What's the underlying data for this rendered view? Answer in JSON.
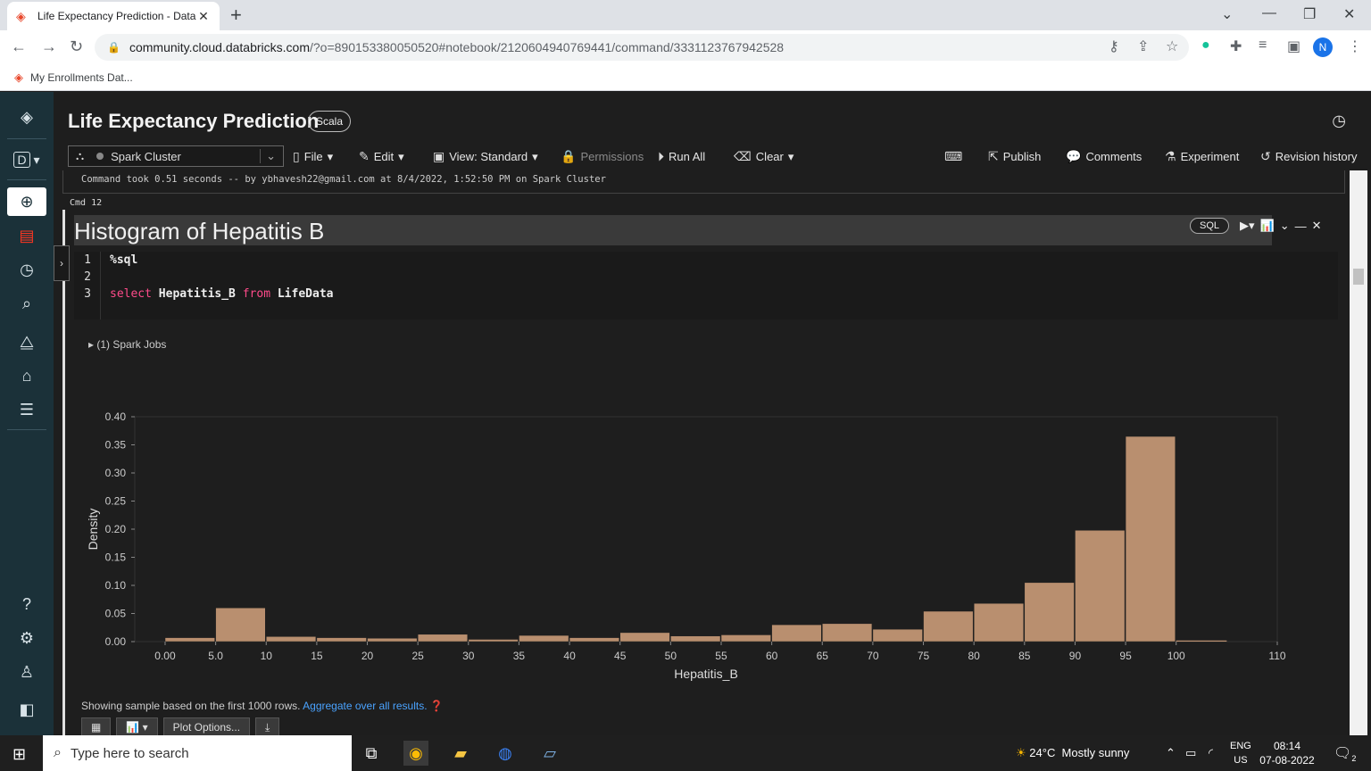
{
  "browser": {
    "tab_title": "Life Expectancy Prediction - Data",
    "url_host": "community.cloud.databricks.com",
    "url_path": "/?o=890153380050520#notebook/2120604940769441/command/3331123767942528",
    "bookmark": "My Enrollments Dat...",
    "profile_initial": "N"
  },
  "leftnav": {
    "workspace_switch": "D"
  },
  "notebook": {
    "title": "Life Expectancy Prediction",
    "language": "Scala",
    "cluster": "Spark Cluster",
    "menu": {
      "file": "File",
      "edit": "Edit",
      "view": "View: Standard",
      "permissions": "Permissions",
      "run_all": "Run All",
      "clear": "Clear",
      "publish": "Publish",
      "comments": "Comments",
      "experiment": "Experiment",
      "revision_history": "Revision history"
    }
  },
  "prev_cell": {
    "status": "Command took 0.51 seconds -- by ybhavesh22@gmail.com at 8/4/2022, 1:52:50 PM on Spark Cluster"
  },
  "cell": {
    "cmd_label": "Cmd 12",
    "title": "Histogram of Hepatitis B",
    "lang_badge": "SQL",
    "line_numbers": [
      "1",
      "2",
      "3"
    ],
    "code_line1": "%sql",
    "code_kw_select": "select",
    "code_col": " Hepatitis_B ",
    "code_kw_from": "from",
    "code_table": " LifeData",
    "spark_jobs": "(1) Spark Jobs",
    "footnote": "Showing sample based on the first 1000 rows.",
    "footnote_link": "Aggregate over all results.",
    "plot_options": "Plot Options..."
  },
  "chart_data": {
    "type": "bar",
    "title": "",
    "xlabel": "Hepatitis_B",
    "ylabel": "Density",
    "bar_color": "#b98f6f",
    "bin_edges": [
      0,
      5,
      10,
      15,
      20,
      25,
      30,
      35,
      40,
      45,
      50,
      55,
      60,
      65,
      70,
      75,
      80,
      85,
      90,
      95,
      100
    ],
    "values": [
      0.007,
      0.06,
      0.009,
      0.007,
      0.006,
      0.013,
      0.004,
      0.011,
      0.007,
      0.016,
      0.01,
      0.012,
      0.03,
      0.032,
      0.022,
      0.054,
      0.068,
      0.105,
      0.198,
      0.365
    ],
    "xticks": [
      "0.00",
      "5.0",
      "10",
      "15",
      "20",
      "25",
      "30",
      "35",
      "40",
      "45",
      "50",
      "55",
      "60",
      "65",
      "70",
      "75",
      "80",
      "85",
      "90",
      "95",
      "100",
      "110"
    ],
    "yticks": [
      "0.00",
      "0.05",
      "0.10",
      "0.15",
      "0.20",
      "0.25",
      "0.30",
      "0.35",
      "0.40"
    ],
    "xlim": [
      -3,
      110
    ],
    "ylim": [
      0,
      0.4
    ],
    "extra_tail_value": 0.002
  },
  "taskbar": {
    "search_placeholder": "Type here to search",
    "weather": "24°C  Mostly sunny",
    "lang_top": "ENG",
    "lang_bottom": "US",
    "time": "08:14",
    "date": "07-08-2022",
    "notif_count": "2"
  }
}
